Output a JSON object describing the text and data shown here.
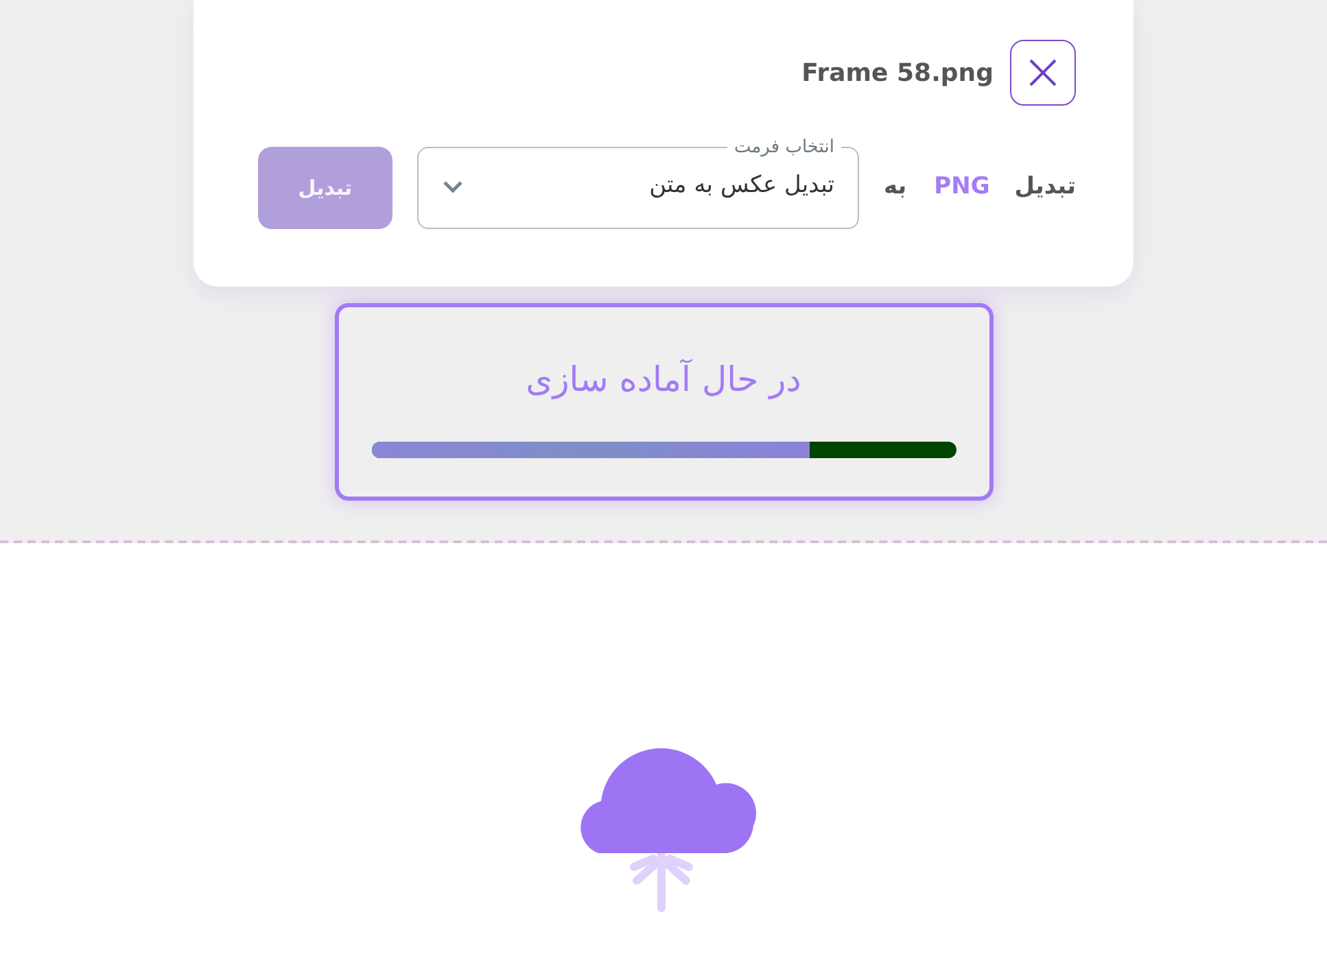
{
  "file": {
    "name": "Frame 58.png"
  },
  "convert": {
    "label": "تبدیل",
    "format": "PNG",
    "to": "به",
    "select": {
      "label": "انتخاب فرمت",
      "value": "تبدیل عکس به متن"
    },
    "button": {
      "label": "تبدیل",
      "disabled": true
    }
  },
  "progress": {
    "label": "در حال آماده سازی",
    "level": 0.75
  }
}
